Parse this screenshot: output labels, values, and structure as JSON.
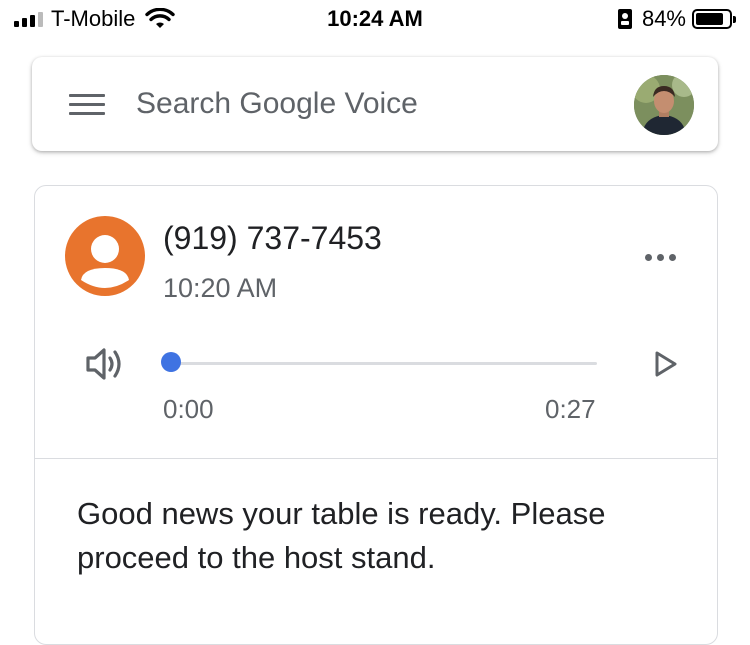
{
  "status_bar": {
    "carrier": "T-Mobile",
    "time": "10:24 AM",
    "battery_percent": "84%",
    "battery_level": 0.84
  },
  "search": {
    "placeholder": "Search Google Voice"
  },
  "voicemail": {
    "phone_number": "(919) 737-7453",
    "time": "10:20 AM",
    "playback": {
      "current": "0:00",
      "duration": "0:27",
      "progress": 0
    },
    "transcript": "Good news your table is ready. Please proceed to the host stand."
  },
  "colors": {
    "contact_avatar": "#e8742d",
    "scrubber": "#3f73e2"
  },
  "icons": {
    "menu": "hamburger-menu-icon",
    "more": "more-horizontal-icon",
    "volume": "speaker-icon",
    "play": "play-icon"
  }
}
